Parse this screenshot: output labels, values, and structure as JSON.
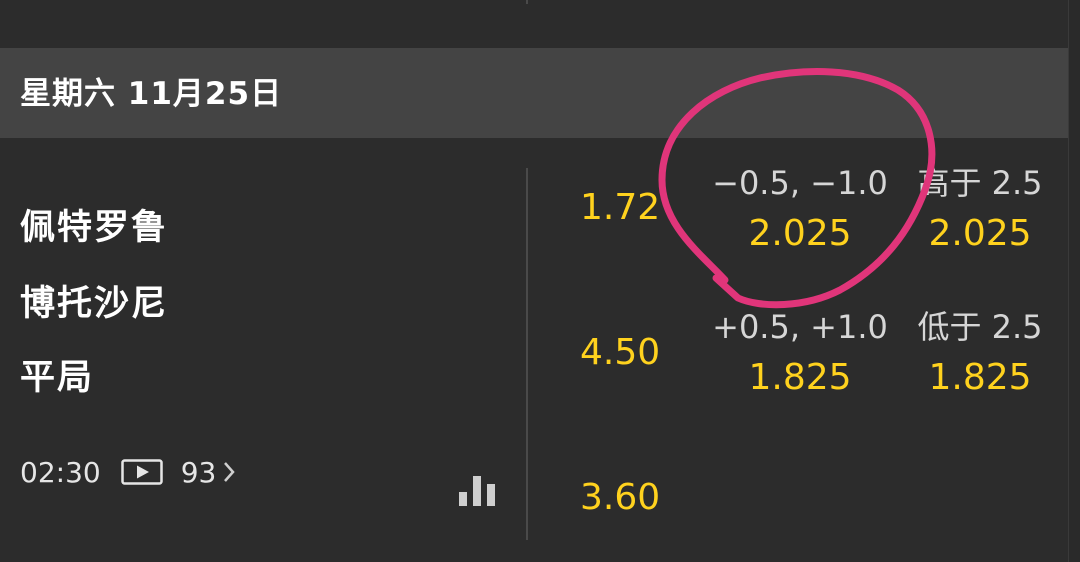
{
  "header": {
    "date": "星期六 11月25日"
  },
  "match": {
    "teams": [
      "佩特罗鲁",
      "博托沙尼",
      "平局"
    ],
    "time": "02:30",
    "market_count": "93",
    "icons": {
      "play": "play-video-icon",
      "chevron": "chevron-right-icon",
      "stats": "bar-chart-icon"
    }
  },
  "odds_1x2": [
    "1.72",
    "4.50",
    "3.60"
  ],
  "handicap": [
    {
      "line": "−0.5, −1.0",
      "odd": "2.025"
    },
    {
      "line": "+0.5, +1.0",
      "odd": "1.825"
    }
  ],
  "totals": [
    {
      "line": "高于 2.5",
      "odd": "2.025"
    },
    {
      "line": "低于 2.5",
      "odd": "1.825"
    }
  ],
  "colors": {
    "background": "#2c2c2c",
    "date_bar": "#444444",
    "odds": "#ffd21e",
    "annotation": "#e0357a"
  }
}
